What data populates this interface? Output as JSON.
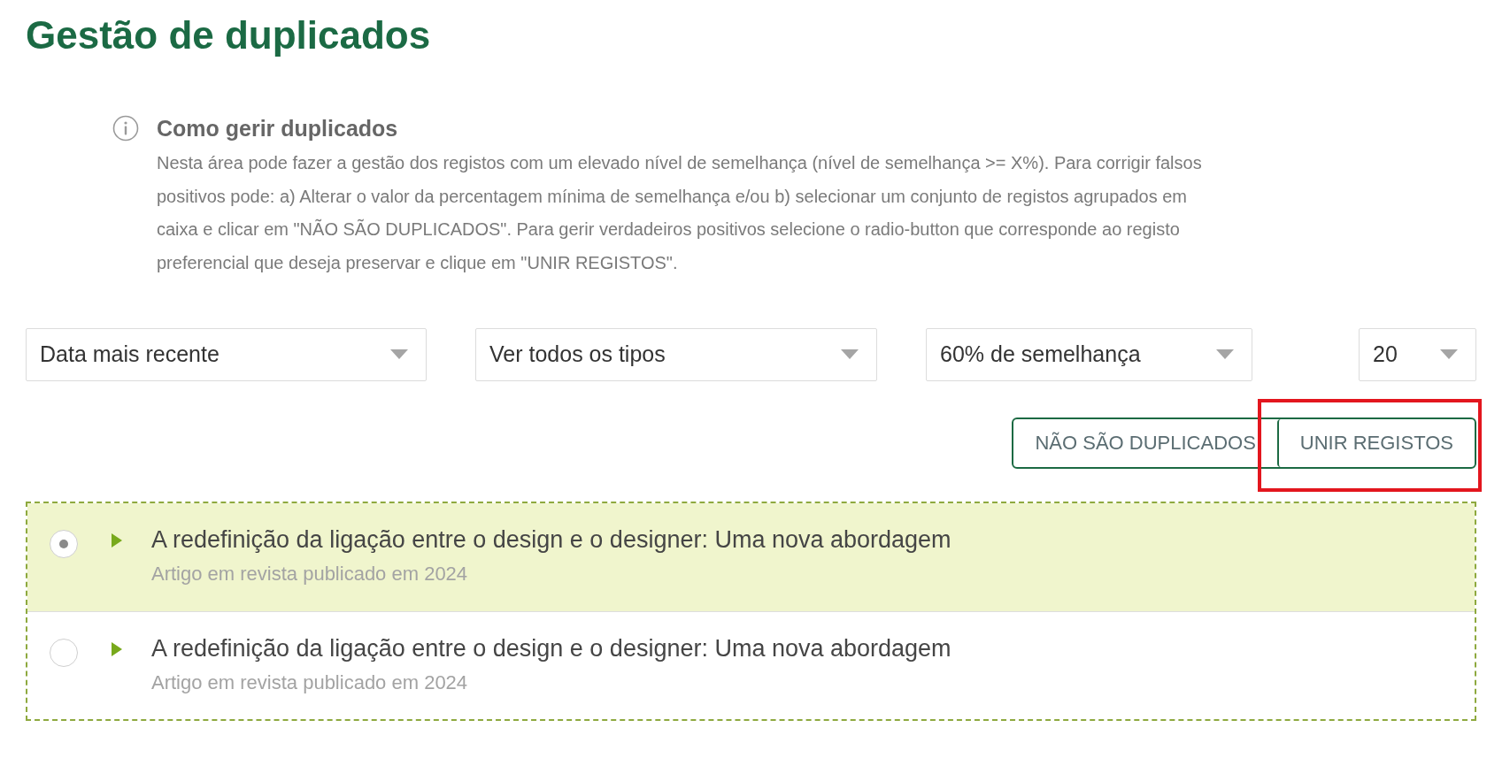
{
  "page": {
    "title": "Gestão de duplicados"
  },
  "info": {
    "heading": "Como gerir duplicados",
    "text": "Nesta área pode fazer a gestão dos registos com um elevado nível de semelhança (nível de semelhança >= X%). Para corrigir falsos positivos pode: a) Alterar o valor da percentagem mínima de semelhança e/ou b) selecionar um conjunto de registos agrupados em caixa e clicar em \"NÃO SÃO DUPLICADOS\". Para gerir verdadeiros positivos selecione o radio-button que corresponde ao registo preferencial que deseja preservar e clique em \"UNIR REGISTOS\"."
  },
  "filters": [
    {
      "value": "Data mais recente"
    },
    {
      "value": "Ver todos os tipos"
    },
    {
      "value": "60% de semelhança"
    },
    {
      "value": "20"
    }
  ],
  "actions": [
    {
      "label": "NÃO SÃO DUPLICADOS",
      "highlighted": false
    },
    {
      "label": "UNIR REGISTOS",
      "highlighted": true
    }
  ],
  "duplicate_group": {
    "records": [
      {
        "title": "A redefinição da ligação entre o design e o designer: Uma nova abordagem",
        "subtitle": "Artigo em revista publicado em 2024",
        "selected": true
      },
      {
        "title": "A redefinição da ligação entre o design e o designer: Uma nova abordagem",
        "subtitle": "Artigo em revista publicado em 2024",
        "selected": false
      }
    ]
  }
}
